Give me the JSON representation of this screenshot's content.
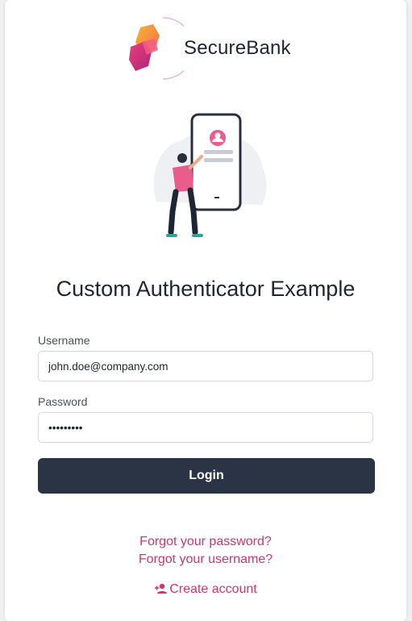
{
  "brand": {
    "name": "SecureBank"
  },
  "page": {
    "title": "Custom Authenticator Example"
  },
  "form": {
    "username_label": "Username",
    "username_value": "john.doe@company.com",
    "password_label": "Password",
    "password_value": "secret123",
    "login_label": "Login"
  },
  "links": {
    "forgot_password": "Forgot your password?",
    "forgot_username": "Forgot your username?",
    "create_account": "Create account"
  },
  "colors": {
    "accent": "#d6336c",
    "button": "#2b3444",
    "text": "#1f2533"
  }
}
